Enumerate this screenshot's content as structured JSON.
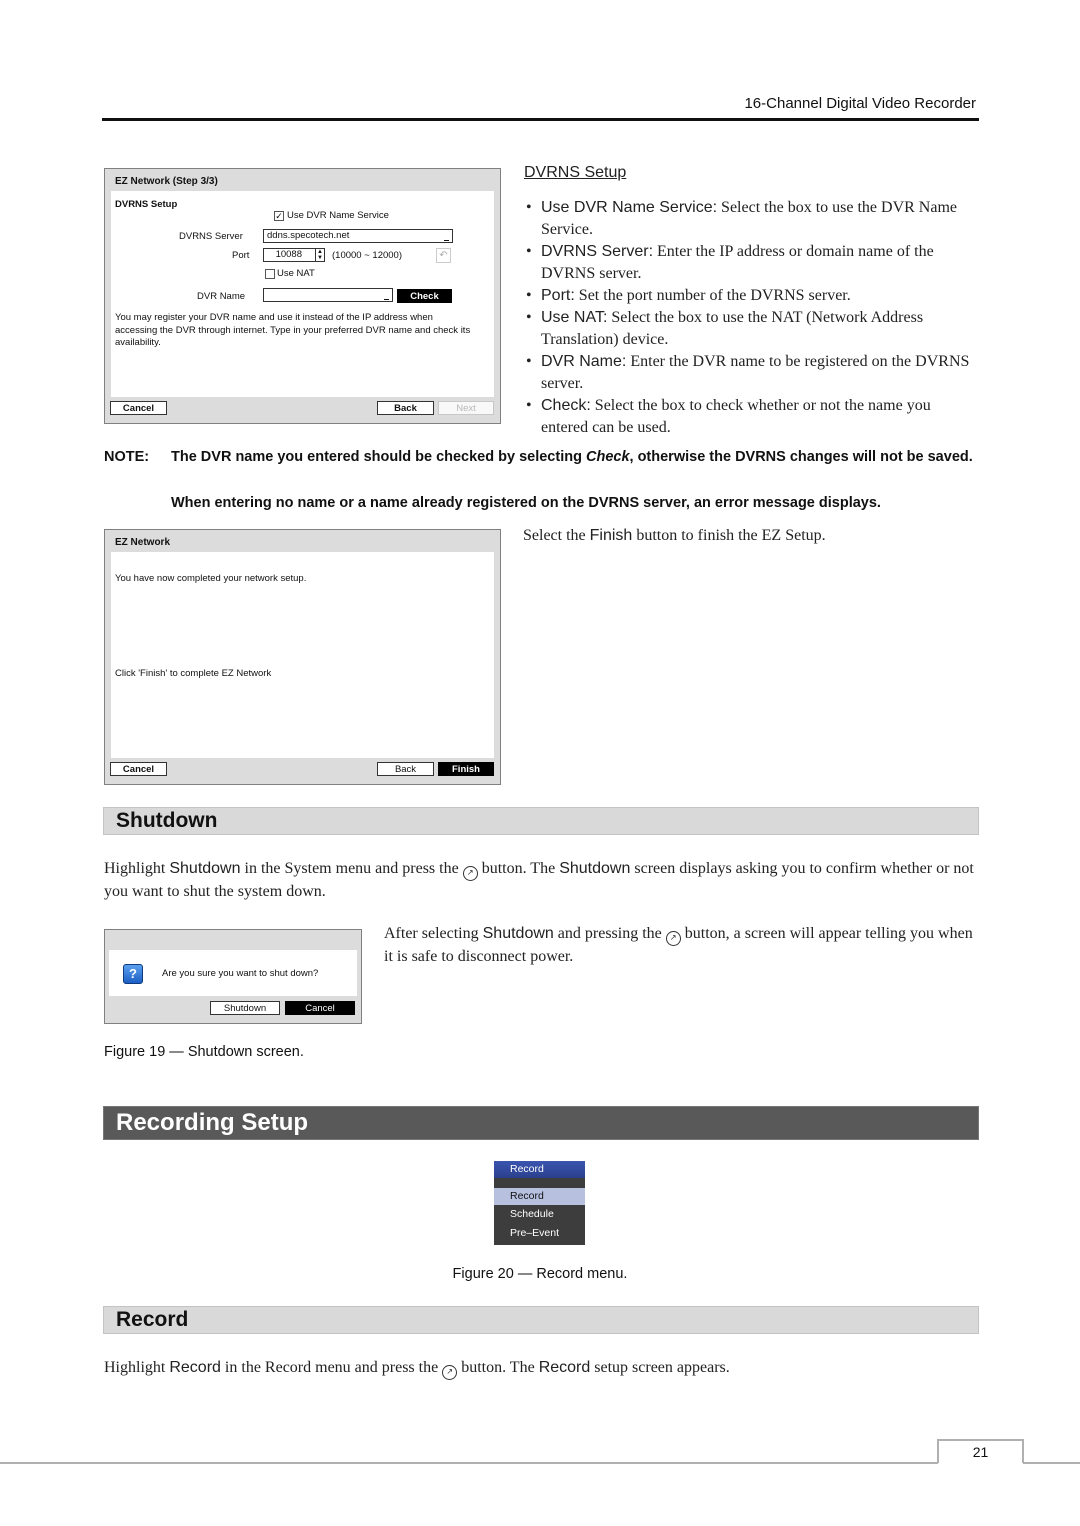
{
  "header": {
    "running_title": "16-Channel Digital Video Recorder"
  },
  "ez_step3": {
    "title": "EZ Network (Step 3/3)",
    "section": "DVRNS Setup",
    "use_dvrns_label": "Use DVR Name Service",
    "use_dvrns_checked": true,
    "server_label": "DVRNS Server",
    "server_value": "ddns.specotech.net",
    "port_label": "Port",
    "port_value": "10088",
    "port_range": "(10000 ~ 12000)",
    "use_nat_label": "Use NAT",
    "use_nat_checked": false,
    "dvr_name_label": "DVR Name",
    "dvr_name_value": "",
    "check_button": "Check",
    "info_text": "You may register your DVR name and use it instead of the IP address when accessing the DVR through internet. Type in your preferred DVR name and check its availability.",
    "cancel_button": "Cancel",
    "back_button": "Back",
    "next_button": "Next"
  },
  "dvrns_help": {
    "heading": "DVRNS Setup",
    "items": [
      {
        "term": "Use DVR Name Service:",
        "desc": "Select the box to use the DVR Name Service."
      },
      {
        "term": "DVRNS Server:",
        "desc": "Enter the IP address or domain name of the DVRNS server."
      },
      {
        "term": "Port:",
        "desc": "Set the port number of the DVRNS server."
      },
      {
        "term": "Use NAT:",
        "desc": "Select the box to use the NAT (Network Address Translation) device."
      },
      {
        "term": "DVR Name:",
        "desc": "Enter the DVR name to be registered on the DVRNS server."
      },
      {
        "term": "Check:",
        "desc": "Select the box to check whether or not the name you entered can be used."
      }
    ]
  },
  "note": {
    "label": "NOTE:",
    "line1_pre": "The DVR name you entered should be checked by selecting ",
    "line1_em": "Check",
    "line1_post": ", otherwise the DVRNS changes will not be saved.",
    "line2": "When entering no name or a name already registered on the DVRNS server, an error message displays."
  },
  "ez_finish": {
    "title": "EZ Network",
    "message1": "You have now completed your network setup.",
    "message2": "Click 'Finish' to complete EZ Network",
    "cancel_button": "Cancel",
    "back_button": "Back",
    "finish_button": "Finish"
  },
  "finish_text": {
    "pre": "Select the ",
    "term": "Finish",
    "post": " button to finish the EZ Setup."
  },
  "shutdown_section": {
    "heading": "Shutdown",
    "para1": {
      "a": "Highlight ",
      "b": "Shutdown",
      "c": " in the System menu and press the ",
      "d": " button.  The ",
      "e": "Shutdown",
      "f": " screen displays asking you to confirm whether or not you want to shut the system down."
    },
    "para2": {
      "a": "After selecting ",
      "b": "Shutdown",
      "c": " and pressing the ",
      "d": " button, a screen will appear telling you when it is safe to disconnect power."
    },
    "dialog": {
      "question": "Are you sure you want to shut down?",
      "shutdown_button": "Shutdown",
      "cancel_button": "Cancel",
      "icon_glyph": "?"
    },
    "caption": "Figure 19 — Shutdown screen."
  },
  "recording_setup": {
    "heading": "Recording Setup"
  },
  "record_menu": {
    "title": "Record",
    "items": [
      "Record",
      "Schedule",
      "Pre–Event"
    ],
    "selected_index": 0,
    "caption": "Figure 20 — Record menu."
  },
  "record_section": {
    "heading": "Record",
    "para": {
      "a": "Highlight ",
      "b": "Record",
      "c": " in the Record menu and press the ",
      "d": " button.  The ",
      "e": "Record",
      "f": " setup screen appears."
    }
  },
  "enter_icon_glyph": "↗",
  "footer": {
    "page_number": "21"
  }
}
